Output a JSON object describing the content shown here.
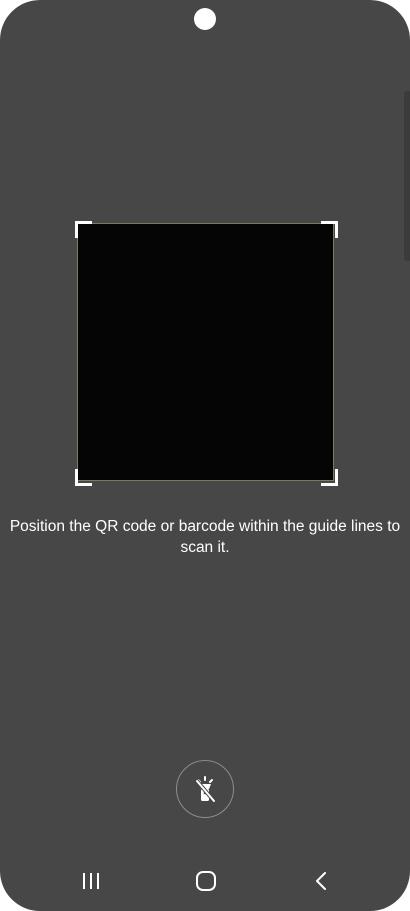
{
  "scanner": {
    "guide_text": "Position the QR code or barcode within the guide lines to scan it."
  },
  "controls": {
    "flash_icon": "flashlight-off-icon"
  },
  "navigation": {
    "recents_icon": "recent-apps-icon",
    "home_icon": "home-icon",
    "back_icon": "back-icon"
  },
  "colors": {
    "background": "#474747",
    "viewfinder": "#050505",
    "guide_corners": "#ffffff",
    "text": "#ffffff"
  }
}
